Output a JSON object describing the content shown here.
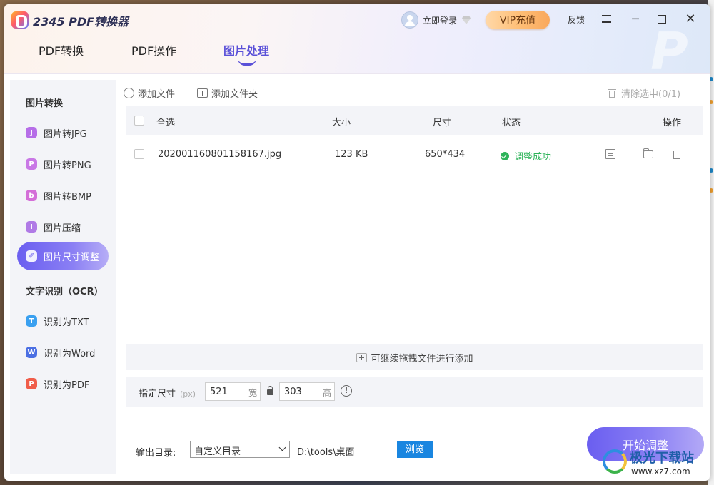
{
  "app": {
    "title": "2345 PDF转换器",
    "login": "立即登录",
    "vip": "VIP充值",
    "feedback": "反馈",
    "minimize": "─",
    "close": "✕"
  },
  "tabs": [
    "PDF转换",
    "PDF操作",
    "图片处理"
  ],
  "sidebar": {
    "heading1": "图片转换",
    "heading2": "文字识别（OCR）",
    "items": [
      {
        "label": "图片转JPG",
        "icon": "J",
        "color": "#b66ee8"
      },
      {
        "label": "图片转PNG",
        "icon": "P",
        "color": "#c978e6"
      },
      {
        "label": "图片转BMP",
        "icon": "b",
        "color": "#d46fd8"
      },
      {
        "label": "图片压缩",
        "icon": "I",
        "color": "#b07ae6"
      },
      {
        "label": "图片尺寸调整",
        "icon": "✐",
        "color": "#6a5ef0"
      },
      {
        "label": "识别为TXT",
        "icon": "T",
        "color": "#3aa0f0"
      },
      {
        "label": "识别为Word",
        "icon": "W",
        "color": "#4b6fe3"
      },
      {
        "label": "识别为PDF",
        "icon": "P",
        "color": "#f05d4a"
      }
    ]
  },
  "toolbar": {
    "add_file": "添加文件",
    "add_folder": "添加文件夹",
    "clear_selected": "清除选中(0/1)"
  },
  "table": {
    "headers": {
      "select_all": "全选",
      "size": "大小",
      "dimensions": "尺寸",
      "status": "状态",
      "actions": "操作"
    },
    "rows": [
      {
        "name": "202001160801158167.jpg",
        "size": "123 KB",
        "dimensions": "650*434",
        "status": "调整成功"
      }
    ]
  },
  "drop_hint": "可继续拖拽文件进行添加",
  "resize": {
    "label": "指定尺寸",
    "unit": "(px)",
    "width": "521",
    "width_suffix": "宽",
    "height": "303",
    "height_suffix": "高",
    "info": "!"
  },
  "output": {
    "label": "输出目录:",
    "select_value": "自定义目录",
    "path": "D:\\tools\\桌面",
    "browse": "浏览"
  },
  "start_button": "开始调整",
  "watermark": {
    "name": "极光下载站",
    "url": "www.xz7.com"
  }
}
